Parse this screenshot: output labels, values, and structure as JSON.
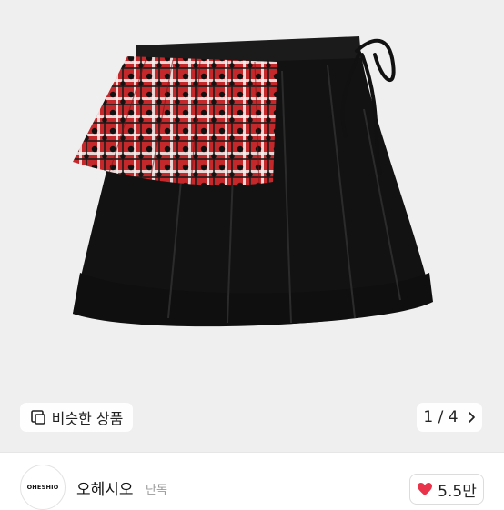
{
  "gallery": {
    "image_alt": "black mini skirt with red plaid pleated overlay",
    "similar_label": "비슷한 상품",
    "pager": {
      "current": "1 / 4"
    }
  },
  "shop": {
    "logo_text": "OHESHIO",
    "name": "오헤시오",
    "badge": "단독",
    "likes": "5.5만"
  },
  "icons": {
    "similar": "similar-items-icon",
    "next": "chevron-right-icon",
    "heart": "heart-icon"
  },
  "colors": {
    "heart": "#e8334a",
    "gallery_bg": "#efefef"
  }
}
